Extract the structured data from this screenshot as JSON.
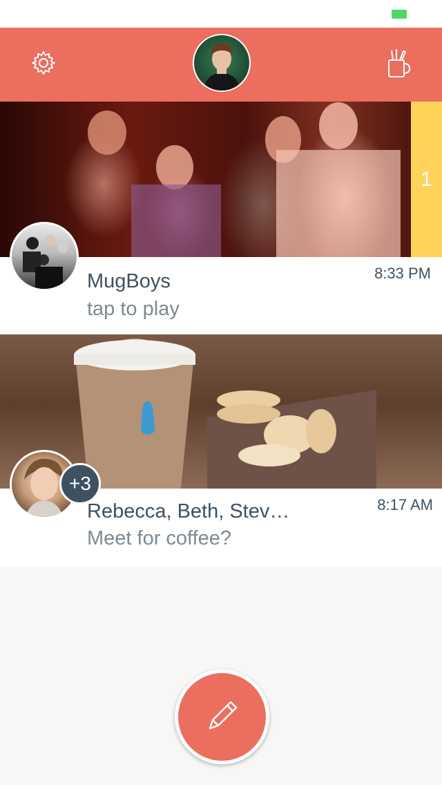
{
  "status_bar": {
    "battery_color": "#4cd964"
  },
  "nav": {
    "background": "#ec6e5e",
    "settings_icon": "gear-icon",
    "new_mug_icon": "mug-with-pens-icon"
  },
  "conversations": [
    {
      "name": "MugBoys",
      "message": "tap to play",
      "time": "8:33 PM",
      "unread_count": "1"
    },
    {
      "name": "Rebecca, Beth, Stev…",
      "message": "Meet for coffee?",
      "time": "8:17 AM",
      "extra_participants": "+3"
    }
  ],
  "compose": {
    "icon": "pencil-icon",
    "color": "#ec6e5e"
  },
  "colors": {
    "accent": "#ec6e5e",
    "unread": "#ffd25a",
    "text_dark": "#3e5162"
  }
}
